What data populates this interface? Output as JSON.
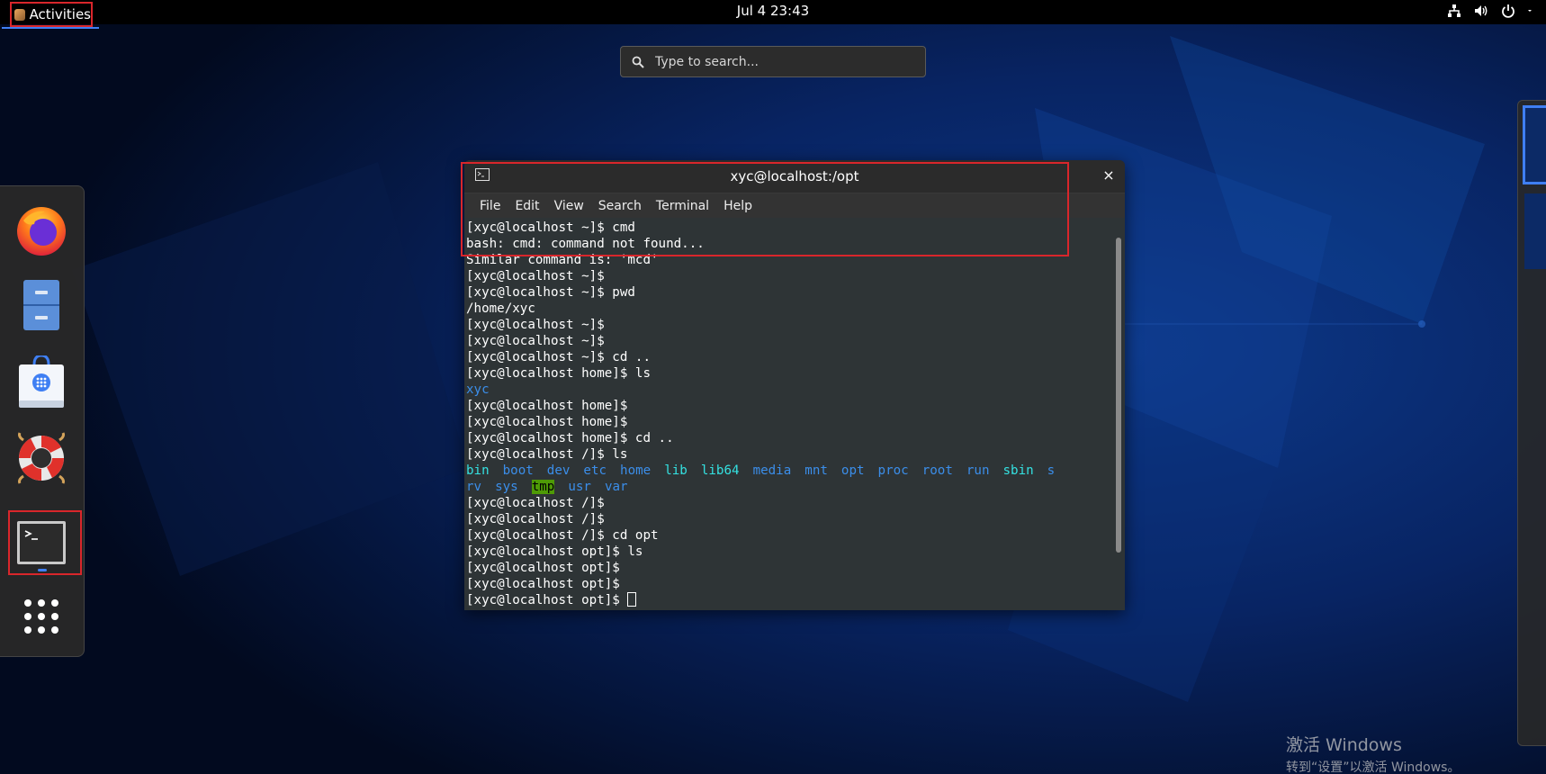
{
  "topbar": {
    "activities_label": "Activities",
    "clock": "Jul 4  23:43",
    "tray_icons": [
      "network-icon",
      "volume-icon",
      "power-icon"
    ]
  },
  "search": {
    "placeholder": "Type to search..."
  },
  "dash": {
    "items": [
      "firefox-icon",
      "files-icon",
      "software-icon",
      "help-icon",
      "terminal-icon",
      "show-apps-icon"
    ]
  },
  "terminal": {
    "title": "xyc@localhost:/opt",
    "close_glyph": "×",
    "menu": [
      "File",
      "Edit",
      "View",
      "Search",
      "Terminal",
      "Help"
    ],
    "lines_top": [
      "[xyc@localhost ~]$ cmd",
      "bash: cmd: command not found...",
      "Similar command is: 'mcd'",
      "[xyc@localhost ~]$",
      "[xyc@localhost ~]$ pwd",
      "/home/xyc",
      "[xyc@localhost ~]$",
      "[xyc@localhost ~]$",
      "[xyc@localhost ~]$ cd ..",
      "[xyc@localhost home]$ ls"
    ],
    "home_listing": "xyc",
    "lines_mid": [
      "[xyc@localhost home]$",
      "[xyc@localhost home]$",
      "[xyc@localhost home]$ cd ..",
      "[xyc@localhost /]$ ls"
    ],
    "root_listing_row1": [
      "bin",
      "boot",
      "dev",
      "etc",
      "home",
      "lib",
      "lib64",
      "media",
      "mnt",
      "opt",
      "proc",
      "root",
      "run",
      "sbin",
      "s"
    ],
    "root_listing_row2": [
      "rv",
      "sys",
      "tmp",
      "usr",
      "var"
    ],
    "lines_bottom": [
      "[xyc@localhost /]$",
      "[xyc@localhost /]$",
      "[xyc@localhost /]$ cd opt",
      "[xyc@localhost opt]$ ls",
      "[xyc@localhost opt]$",
      "[xyc@localhost opt]$"
    ],
    "prompt_last": "[xyc@localhost opt]$ "
  },
  "watermark": {
    "line1": "激活 Windows",
    "line2": "转到“设置”以激活 Windows。"
  },
  "colors": {
    "highlight_red": "#d9262b",
    "accent_blue": "#3f7ff3",
    "terminal_bg": "#2e3436",
    "ls_dir_blue": "#3b8eea",
    "ls_link_cyan": "#34e2e2"
  }
}
